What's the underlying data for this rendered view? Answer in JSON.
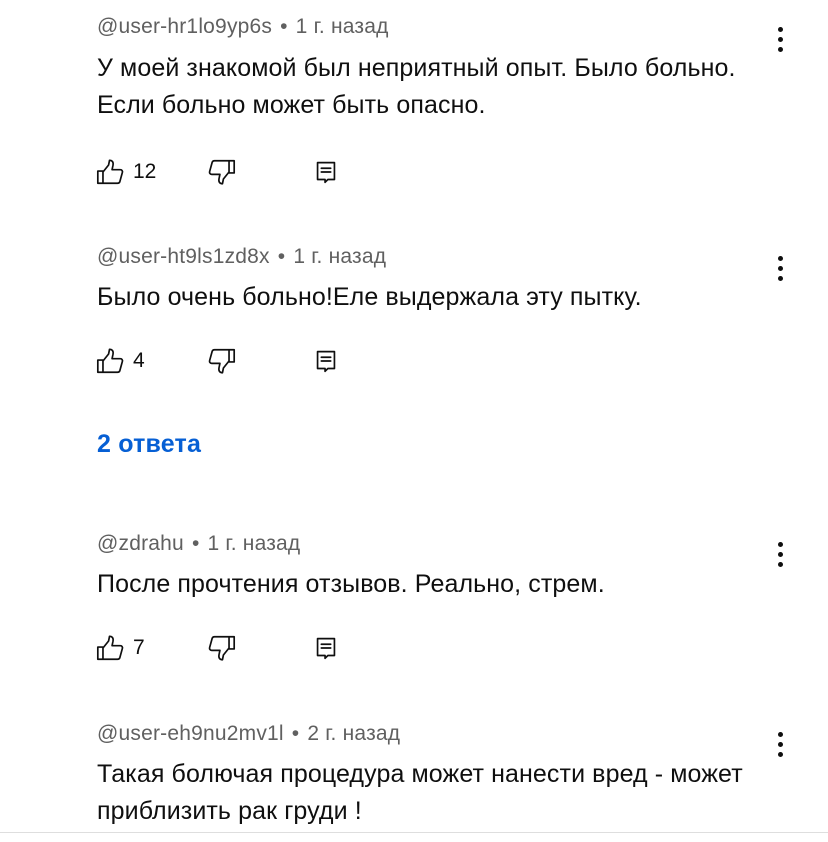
{
  "comments": [
    {
      "author": "@user-hr1lo9yp6s",
      "time": "1 г. назад",
      "text": "У моей знакомой был неприятный опыт. Было больно. Если больно может быть опасно.",
      "likes": "12"
    },
    {
      "author": "@user-ht9ls1zd8x",
      "time": "1 г. назад",
      "text": "Было очень больно!Еле выдержала эту пытку.",
      "likes": "4"
    },
    {
      "author": "@zdrahu",
      "time": "1 г. назад",
      "text": "После прочтения отзывов. Реально, стрем.",
      "likes": "7"
    },
    {
      "author": "@user-eh9nu2mv1l",
      "time": "2 г. назад",
      "text": "Такая болючая процедура может нанести вред - может приблизить рак груди  !"
    }
  ],
  "replies_link": "2 ответа",
  "meta_separator": "•",
  "icons": {
    "like": "thumbs-up-icon",
    "dislike": "thumbs-down-icon",
    "reply": "reply-icon",
    "more": "more-vertical-icon"
  },
  "colors": {
    "text": "#0f0f0f",
    "meta": "#606060",
    "link": "#065fd4"
  }
}
